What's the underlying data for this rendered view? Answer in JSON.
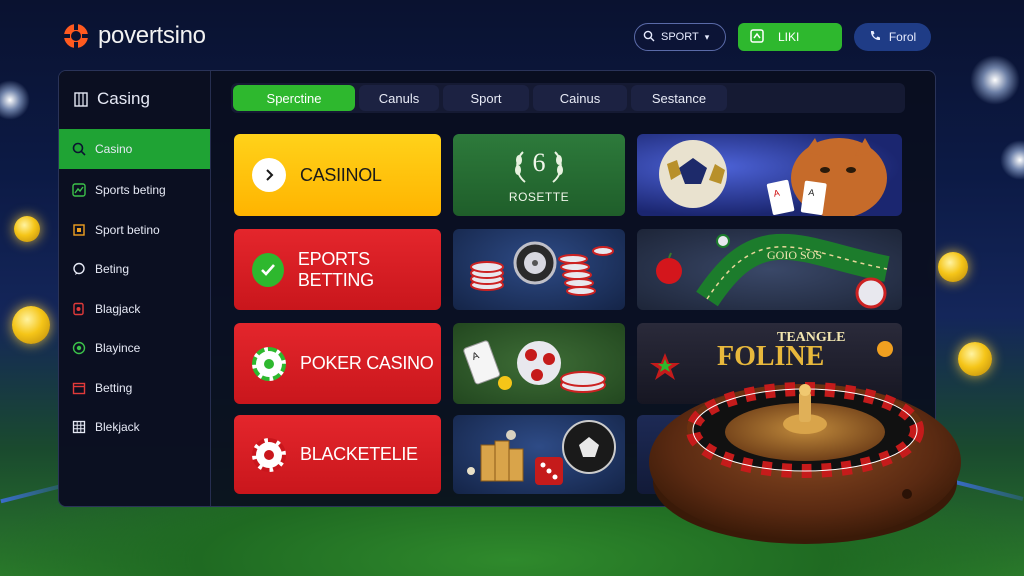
{
  "brand": {
    "name": "povertsino",
    "accent": "#ff5a1f"
  },
  "header": {
    "search_label": "SPORT",
    "like_label": "LIKI",
    "forol_label": "Forol"
  },
  "sidebar": {
    "title": "Casing",
    "items": [
      {
        "label": "Casino",
        "icon": "search-icon",
        "active": true
      },
      {
        "label": "Sports beting",
        "icon": "stats-icon",
        "active": false
      },
      {
        "label": "Sport betino",
        "icon": "ticket-icon",
        "active": false
      },
      {
        "label": "Beting",
        "icon": "chat-icon",
        "active": false
      },
      {
        "label": "Blagjack",
        "icon": "cards-icon",
        "active": false
      },
      {
        "label": "Blayince",
        "icon": "chip-icon",
        "active": false
      },
      {
        "label": "Betting",
        "icon": "calendar-icon",
        "active": false
      },
      {
        "label": "Blekjack",
        "icon": "grid-icon",
        "active": false
      }
    ]
  },
  "tabs": [
    {
      "label": "Sperctine",
      "active": true
    },
    {
      "label": "Canuls",
      "active": false
    },
    {
      "label": "Sport",
      "active": false
    },
    {
      "label": "Cainus",
      "active": false
    },
    {
      "label": "Sestance",
      "active": false
    }
  ],
  "categories": [
    {
      "label": "CASIINOL",
      "color": "yellow",
      "icon": "chevron-right-icon"
    },
    {
      "label": "EPORTS BETTING",
      "color": "red",
      "icon": "check-icon"
    },
    {
      "label": "POKER CASINO",
      "color": "red",
      "icon": "poker-chip-icon"
    },
    {
      "label": "BLACKETELIE",
      "color": "red",
      "icon": "poker-chip-icon"
    }
  ],
  "tiles": {
    "roulette_number": "6",
    "roulette_label": "ROSETTE",
    "slot_words": "GOIO SOS",
    "fortune_title": "TEANGLE",
    "fortune_word": "FOLINE"
  }
}
